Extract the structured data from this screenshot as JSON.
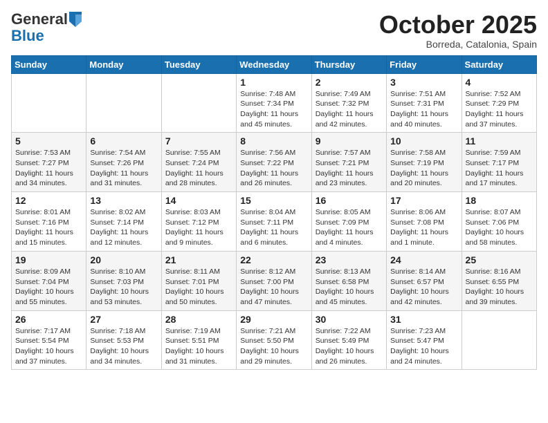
{
  "header": {
    "logo_general": "General",
    "logo_blue": "Blue",
    "month": "October 2025",
    "location": "Borreda, Catalonia, Spain"
  },
  "days_of_week": [
    "Sunday",
    "Monday",
    "Tuesday",
    "Wednesday",
    "Thursday",
    "Friday",
    "Saturday"
  ],
  "weeks": [
    [
      {
        "day": "",
        "info": ""
      },
      {
        "day": "",
        "info": ""
      },
      {
        "day": "",
        "info": ""
      },
      {
        "day": "1",
        "info": "Sunrise: 7:48 AM\nSunset: 7:34 PM\nDaylight: 11 hours and 45 minutes."
      },
      {
        "day": "2",
        "info": "Sunrise: 7:49 AM\nSunset: 7:32 PM\nDaylight: 11 hours and 42 minutes."
      },
      {
        "day": "3",
        "info": "Sunrise: 7:51 AM\nSunset: 7:31 PM\nDaylight: 11 hours and 40 minutes."
      },
      {
        "day": "4",
        "info": "Sunrise: 7:52 AM\nSunset: 7:29 PM\nDaylight: 11 hours and 37 minutes."
      }
    ],
    [
      {
        "day": "5",
        "info": "Sunrise: 7:53 AM\nSunset: 7:27 PM\nDaylight: 11 hours and 34 minutes."
      },
      {
        "day": "6",
        "info": "Sunrise: 7:54 AM\nSunset: 7:26 PM\nDaylight: 11 hours and 31 minutes."
      },
      {
        "day": "7",
        "info": "Sunrise: 7:55 AM\nSunset: 7:24 PM\nDaylight: 11 hours and 28 minutes."
      },
      {
        "day": "8",
        "info": "Sunrise: 7:56 AM\nSunset: 7:22 PM\nDaylight: 11 hours and 26 minutes."
      },
      {
        "day": "9",
        "info": "Sunrise: 7:57 AM\nSunset: 7:21 PM\nDaylight: 11 hours and 23 minutes."
      },
      {
        "day": "10",
        "info": "Sunrise: 7:58 AM\nSunset: 7:19 PM\nDaylight: 11 hours and 20 minutes."
      },
      {
        "day": "11",
        "info": "Sunrise: 7:59 AM\nSunset: 7:17 PM\nDaylight: 11 hours and 17 minutes."
      }
    ],
    [
      {
        "day": "12",
        "info": "Sunrise: 8:01 AM\nSunset: 7:16 PM\nDaylight: 11 hours and 15 minutes."
      },
      {
        "day": "13",
        "info": "Sunrise: 8:02 AM\nSunset: 7:14 PM\nDaylight: 11 hours and 12 minutes."
      },
      {
        "day": "14",
        "info": "Sunrise: 8:03 AM\nSunset: 7:12 PM\nDaylight: 11 hours and 9 minutes."
      },
      {
        "day": "15",
        "info": "Sunrise: 8:04 AM\nSunset: 7:11 PM\nDaylight: 11 hours and 6 minutes."
      },
      {
        "day": "16",
        "info": "Sunrise: 8:05 AM\nSunset: 7:09 PM\nDaylight: 11 hours and 4 minutes."
      },
      {
        "day": "17",
        "info": "Sunrise: 8:06 AM\nSunset: 7:08 PM\nDaylight: 11 hours and 1 minute."
      },
      {
        "day": "18",
        "info": "Sunrise: 8:07 AM\nSunset: 7:06 PM\nDaylight: 10 hours and 58 minutes."
      }
    ],
    [
      {
        "day": "19",
        "info": "Sunrise: 8:09 AM\nSunset: 7:04 PM\nDaylight: 10 hours and 55 minutes."
      },
      {
        "day": "20",
        "info": "Sunrise: 8:10 AM\nSunset: 7:03 PM\nDaylight: 10 hours and 53 minutes."
      },
      {
        "day": "21",
        "info": "Sunrise: 8:11 AM\nSunset: 7:01 PM\nDaylight: 10 hours and 50 minutes."
      },
      {
        "day": "22",
        "info": "Sunrise: 8:12 AM\nSunset: 7:00 PM\nDaylight: 10 hours and 47 minutes."
      },
      {
        "day": "23",
        "info": "Sunrise: 8:13 AM\nSunset: 6:58 PM\nDaylight: 10 hours and 45 minutes."
      },
      {
        "day": "24",
        "info": "Sunrise: 8:14 AM\nSunset: 6:57 PM\nDaylight: 10 hours and 42 minutes."
      },
      {
        "day": "25",
        "info": "Sunrise: 8:16 AM\nSunset: 6:55 PM\nDaylight: 10 hours and 39 minutes."
      }
    ],
    [
      {
        "day": "26",
        "info": "Sunrise: 7:17 AM\nSunset: 5:54 PM\nDaylight: 10 hours and 37 minutes."
      },
      {
        "day": "27",
        "info": "Sunrise: 7:18 AM\nSunset: 5:53 PM\nDaylight: 10 hours and 34 minutes."
      },
      {
        "day": "28",
        "info": "Sunrise: 7:19 AM\nSunset: 5:51 PM\nDaylight: 10 hours and 31 minutes."
      },
      {
        "day": "29",
        "info": "Sunrise: 7:21 AM\nSunset: 5:50 PM\nDaylight: 10 hours and 29 minutes."
      },
      {
        "day": "30",
        "info": "Sunrise: 7:22 AM\nSunset: 5:49 PM\nDaylight: 10 hours and 26 minutes."
      },
      {
        "day": "31",
        "info": "Sunrise: 7:23 AM\nSunset: 5:47 PM\nDaylight: 10 hours and 24 minutes."
      },
      {
        "day": "",
        "info": ""
      }
    ]
  ]
}
